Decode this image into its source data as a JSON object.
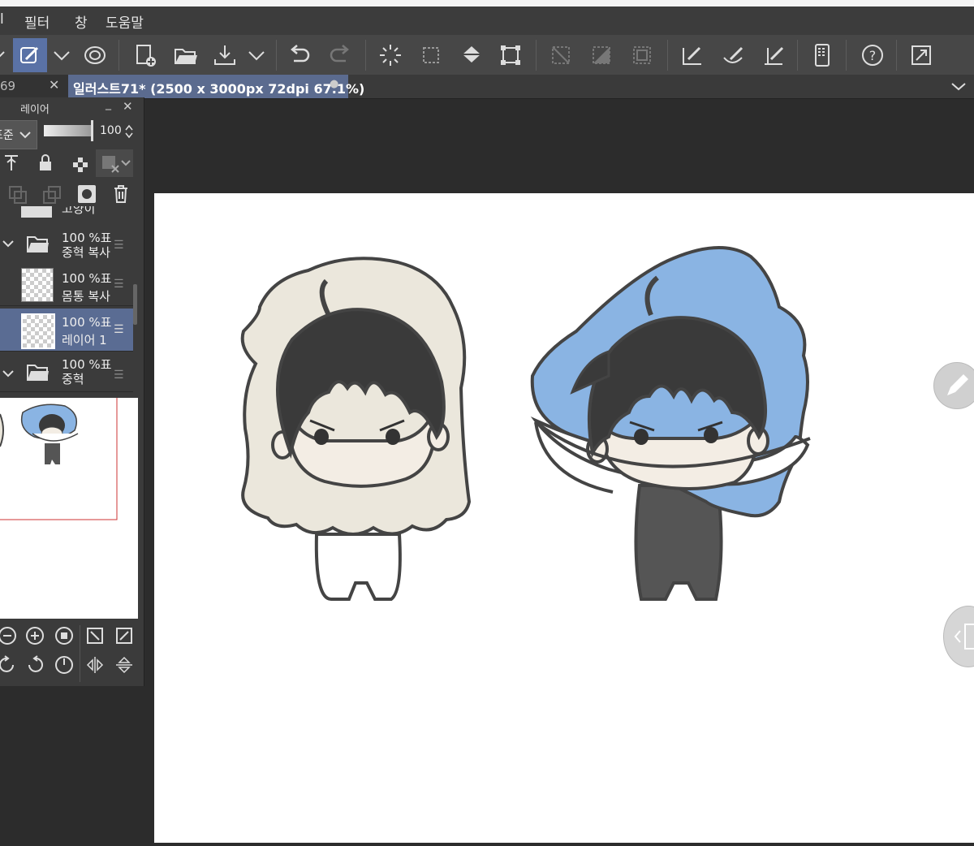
{
  "menu": {
    "partial_left": "l",
    "items": [
      "필터",
      "창",
      "도움말"
    ]
  },
  "tabs": {
    "inactive_label": "69",
    "active_label": "일러스트71* (2500 x 3000px 72dpi 67.1%)"
  },
  "layer_panel": {
    "title": "레이어",
    "blend_mode": "표준",
    "opacity": "100",
    "partial_top_label": "고양이",
    "layers": [
      {
        "percent": "100 %표",
        "name": "중혁 복사",
        "type": "folder"
      },
      {
        "percent": "100 %표",
        "name": "몸통 복사",
        "type": "layer"
      },
      {
        "percent": "100 %표",
        "name": "레이어 1",
        "type": "layer",
        "selected": true
      },
      {
        "percent": "100 %표",
        "name": "중혁",
        "type": "folder"
      }
    ]
  },
  "colors": {
    "accent": "#5a72a6",
    "selected_row": "#5a6c93",
    "hood_beige": "#ebe7dc",
    "pillow_blue": "#8ab4e3",
    "hair": "#3a3a3a",
    "skin": "#f3ede4"
  }
}
